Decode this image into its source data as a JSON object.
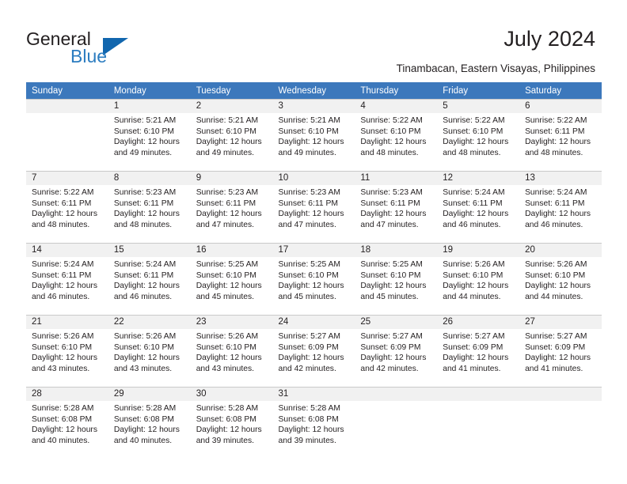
{
  "brand": {
    "name_part1": "General",
    "name_part2": "Blue",
    "accent_color": "#1166ae",
    "blue_text_color": "#2b7cc0"
  },
  "header": {
    "title": "July 2024",
    "location": "Tinambacan, Eastern Visayas, Philippines",
    "header_bg_color": "#3c78bc",
    "day_band_color": "#f1f1f1"
  },
  "calendar": {
    "weekday_headers": [
      "Sunday",
      "Monday",
      "Tuesday",
      "Wednesday",
      "Thursday",
      "Friday",
      "Saturday"
    ],
    "weeks": [
      [
        {
          "day": "",
          "sunrise": "",
          "sunset": "",
          "daylight_line1": "",
          "daylight_line2": ""
        },
        {
          "day": "1",
          "sunrise": "Sunrise: 5:21 AM",
          "sunset": "Sunset: 6:10 PM",
          "daylight_line1": "Daylight: 12 hours",
          "daylight_line2": "and 49 minutes."
        },
        {
          "day": "2",
          "sunrise": "Sunrise: 5:21 AM",
          "sunset": "Sunset: 6:10 PM",
          "daylight_line1": "Daylight: 12 hours",
          "daylight_line2": "and 49 minutes."
        },
        {
          "day": "3",
          "sunrise": "Sunrise: 5:21 AM",
          "sunset": "Sunset: 6:10 PM",
          "daylight_line1": "Daylight: 12 hours",
          "daylight_line2": "and 49 minutes."
        },
        {
          "day": "4",
          "sunrise": "Sunrise: 5:22 AM",
          "sunset": "Sunset: 6:10 PM",
          "daylight_line1": "Daylight: 12 hours",
          "daylight_line2": "and 48 minutes."
        },
        {
          "day": "5",
          "sunrise": "Sunrise: 5:22 AM",
          "sunset": "Sunset: 6:10 PM",
          "daylight_line1": "Daylight: 12 hours",
          "daylight_line2": "and 48 minutes."
        },
        {
          "day": "6",
          "sunrise": "Sunrise: 5:22 AM",
          "sunset": "Sunset: 6:11 PM",
          "daylight_line1": "Daylight: 12 hours",
          "daylight_line2": "and 48 minutes."
        }
      ],
      [
        {
          "day": "7",
          "sunrise": "Sunrise: 5:22 AM",
          "sunset": "Sunset: 6:11 PM",
          "daylight_line1": "Daylight: 12 hours",
          "daylight_line2": "and 48 minutes."
        },
        {
          "day": "8",
          "sunrise": "Sunrise: 5:23 AM",
          "sunset": "Sunset: 6:11 PM",
          "daylight_line1": "Daylight: 12 hours",
          "daylight_line2": "and 48 minutes."
        },
        {
          "day": "9",
          "sunrise": "Sunrise: 5:23 AM",
          "sunset": "Sunset: 6:11 PM",
          "daylight_line1": "Daylight: 12 hours",
          "daylight_line2": "and 47 minutes."
        },
        {
          "day": "10",
          "sunrise": "Sunrise: 5:23 AM",
          "sunset": "Sunset: 6:11 PM",
          "daylight_line1": "Daylight: 12 hours",
          "daylight_line2": "and 47 minutes."
        },
        {
          "day": "11",
          "sunrise": "Sunrise: 5:23 AM",
          "sunset": "Sunset: 6:11 PM",
          "daylight_line1": "Daylight: 12 hours",
          "daylight_line2": "and 47 minutes."
        },
        {
          "day": "12",
          "sunrise": "Sunrise: 5:24 AM",
          "sunset": "Sunset: 6:11 PM",
          "daylight_line1": "Daylight: 12 hours",
          "daylight_line2": "and 46 minutes."
        },
        {
          "day": "13",
          "sunrise": "Sunrise: 5:24 AM",
          "sunset": "Sunset: 6:11 PM",
          "daylight_line1": "Daylight: 12 hours",
          "daylight_line2": "and 46 minutes."
        }
      ],
      [
        {
          "day": "14",
          "sunrise": "Sunrise: 5:24 AM",
          "sunset": "Sunset: 6:11 PM",
          "daylight_line1": "Daylight: 12 hours",
          "daylight_line2": "and 46 minutes."
        },
        {
          "day": "15",
          "sunrise": "Sunrise: 5:24 AM",
          "sunset": "Sunset: 6:11 PM",
          "daylight_line1": "Daylight: 12 hours",
          "daylight_line2": "and 46 minutes."
        },
        {
          "day": "16",
          "sunrise": "Sunrise: 5:25 AM",
          "sunset": "Sunset: 6:10 PM",
          "daylight_line1": "Daylight: 12 hours",
          "daylight_line2": "and 45 minutes."
        },
        {
          "day": "17",
          "sunrise": "Sunrise: 5:25 AM",
          "sunset": "Sunset: 6:10 PM",
          "daylight_line1": "Daylight: 12 hours",
          "daylight_line2": "and 45 minutes."
        },
        {
          "day": "18",
          "sunrise": "Sunrise: 5:25 AM",
          "sunset": "Sunset: 6:10 PM",
          "daylight_line1": "Daylight: 12 hours",
          "daylight_line2": "and 45 minutes."
        },
        {
          "day": "19",
          "sunrise": "Sunrise: 5:26 AM",
          "sunset": "Sunset: 6:10 PM",
          "daylight_line1": "Daylight: 12 hours",
          "daylight_line2": "and 44 minutes."
        },
        {
          "day": "20",
          "sunrise": "Sunrise: 5:26 AM",
          "sunset": "Sunset: 6:10 PM",
          "daylight_line1": "Daylight: 12 hours",
          "daylight_line2": "and 44 minutes."
        }
      ],
      [
        {
          "day": "21",
          "sunrise": "Sunrise: 5:26 AM",
          "sunset": "Sunset: 6:10 PM",
          "daylight_line1": "Daylight: 12 hours",
          "daylight_line2": "and 43 minutes."
        },
        {
          "day": "22",
          "sunrise": "Sunrise: 5:26 AM",
          "sunset": "Sunset: 6:10 PM",
          "daylight_line1": "Daylight: 12 hours",
          "daylight_line2": "and 43 minutes."
        },
        {
          "day": "23",
          "sunrise": "Sunrise: 5:26 AM",
          "sunset": "Sunset: 6:10 PM",
          "daylight_line1": "Daylight: 12 hours",
          "daylight_line2": "and 43 minutes."
        },
        {
          "day": "24",
          "sunrise": "Sunrise: 5:27 AM",
          "sunset": "Sunset: 6:09 PM",
          "daylight_line1": "Daylight: 12 hours",
          "daylight_line2": "and 42 minutes."
        },
        {
          "day": "25",
          "sunrise": "Sunrise: 5:27 AM",
          "sunset": "Sunset: 6:09 PM",
          "daylight_line1": "Daylight: 12 hours",
          "daylight_line2": "and 42 minutes."
        },
        {
          "day": "26",
          "sunrise": "Sunrise: 5:27 AM",
          "sunset": "Sunset: 6:09 PM",
          "daylight_line1": "Daylight: 12 hours",
          "daylight_line2": "and 41 minutes."
        },
        {
          "day": "27",
          "sunrise": "Sunrise: 5:27 AM",
          "sunset": "Sunset: 6:09 PM",
          "daylight_line1": "Daylight: 12 hours",
          "daylight_line2": "and 41 minutes."
        }
      ],
      [
        {
          "day": "28",
          "sunrise": "Sunrise: 5:28 AM",
          "sunset": "Sunset: 6:08 PM",
          "daylight_line1": "Daylight: 12 hours",
          "daylight_line2": "and 40 minutes."
        },
        {
          "day": "29",
          "sunrise": "Sunrise: 5:28 AM",
          "sunset": "Sunset: 6:08 PM",
          "daylight_line1": "Daylight: 12 hours",
          "daylight_line2": "and 40 minutes."
        },
        {
          "day": "30",
          "sunrise": "Sunrise: 5:28 AM",
          "sunset": "Sunset: 6:08 PM",
          "daylight_line1": "Daylight: 12 hours",
          "daylight_line2": "and 39 minutes."
        },
        {
          "day": "31",
          "sunrise": "Sunrise: 5:28 AM",
          "sunset": "Sunset: 6:08 PM",
          "daylight_line1": "Daylight: 12 hours",
          "daylight_line2": "and 39 minutes."
        },
        {
          "day": "",
          "sunrise": "",
          "sunset": "",
          "daylight_line1": "",
          "daylight_line2": ""
        },
        {
          "day": "",
          "sunrise": "",
          "sunset": "",
          "daylight_line1": "",
          "daylight_line2": ""
        },
        {
          "day": "",
          "sunrise": "",
          "sunset": "",
          "daylight_line1": "",
          "daylight_line2": ""
        }
      ]
    ]
  }
}
